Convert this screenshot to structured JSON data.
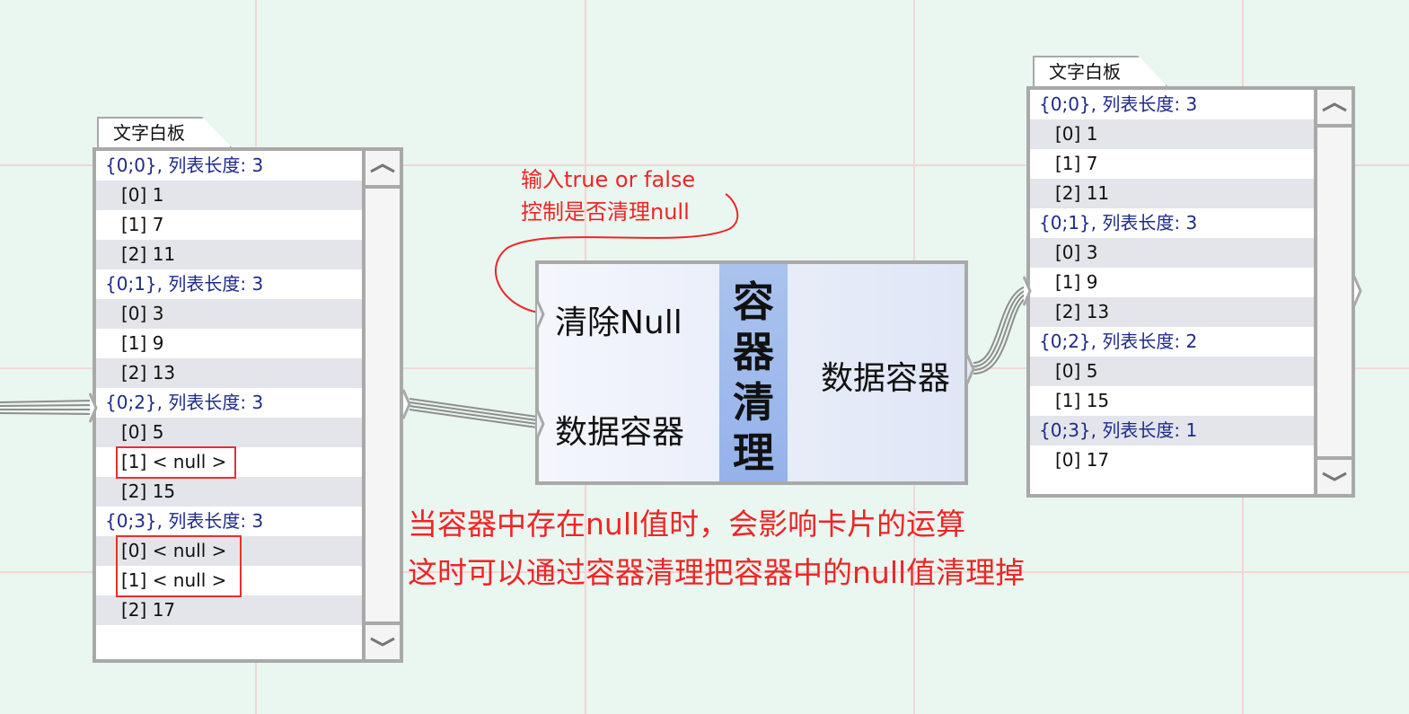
{
  "left_panel": {
    "tab_label": "文字白板",
    "rows": [
      {
        "kind": "header",
        "text": "{0;0}, 列表长度: 3"
      },
      {
        "kind": "item",
        "text": "[0] 1"
      },
      {
        "kind": "item",
        "text": "[1] 7"
      },
      {
        "kind": "item",
        "text": "[2] 11"
      },
      {
        "kind": "header",
        "text": "{0;1}, 列表长度: 3"
      },
      {
        "kind": "item",
        "text": "[0] 3"
      },
      {
        "kind": "item",
        "text": "[1] 9"
      },
      {
        "kind": "item",
        "text": "[2] 13"
      },
      {
        "kind": "header",
        "text": "{0;2}, 列表长度: 3"
      },
      {
        "kind": "item",
        "text": "[0] 5"
      },
      {
        "kind": "item",
        "text": "[1] < null >"
      },
      {
        "kind": "item",
        "text": "[2] 15"
      },
      {
        "kind": "header",
        "text": "{0;3}, 列表长度: 3"
      },
      {
        "kind": "item",
        "text": "[0] < null >"
      },
      {
        "kind": "item",
        "text": "[1] < null >"
      },
      {
        "kind": "item",
        "text": "[2] 17"
      }
    ]
  },
  "right_panel": {
    "tab_label": "文字白板",
    "rows": [
      {
        "kind": "header",
        "text": "{0;0}, 列表长度: 3"
      },
      {
        "kind": "item",
        "text": "[0] 1"
      },
      {
        "kind": "item",
        "text": "[1] 7"
      },
      {
        "kind": "item",
        "text": "[2] 11"
      },
      {
        "kind": "header",
        "text": "{0;1}, 列表长度: 3"
      },
      {
        "kind": "item",
        "text": "[0] 3"
      },
      {
        "kind": "item",
        "text": "[1] 9"
      },
      {
        "kind": "item",
        "text": "[2] 13"
      },
      {
        "kind": "header",
        "text": "{0;2}, 列表长度: 2"
      },
      {
        "kind": "item",
        "text": "[0] 5"
      },
      {
        "kind": "item",
        "text": "[1] 15"
      },
      {
        "kind": "header",
        "text": "{0;3}, 列表长度: 1"
      },
      {
        "kind": "item",
        "text": "[0] 17"
      }
    ]
  },
  "component": {
    "title": "容器清理",
    "input_clear_null": "清除Null",
    "input_data": "数据容器",
    "output_data": "数据容器"
  },
  "annotations": {
    "input_hint_line1": "输入true or false",
    "input_hint_line2": "控制是否清理null",
    "note_line1": "当容器中存在null值时，会影响卡片的运算",
    "note_line2": "这时可以通过容器清理把容器中的null值清理掉"
  },
  "colors": {
    "background": "#eaf6f0",
    "grid_line": "#f3d6d6",
    "header_text": "#1e2a8c",
    "annotation_red": "#ee2525",
    "component_band": "#95b2ea"
  },
  "icons": {
    "scroll_up": "chevron-up-icon",
    "scroll_down": "chevron-down-icon"
  }
}
